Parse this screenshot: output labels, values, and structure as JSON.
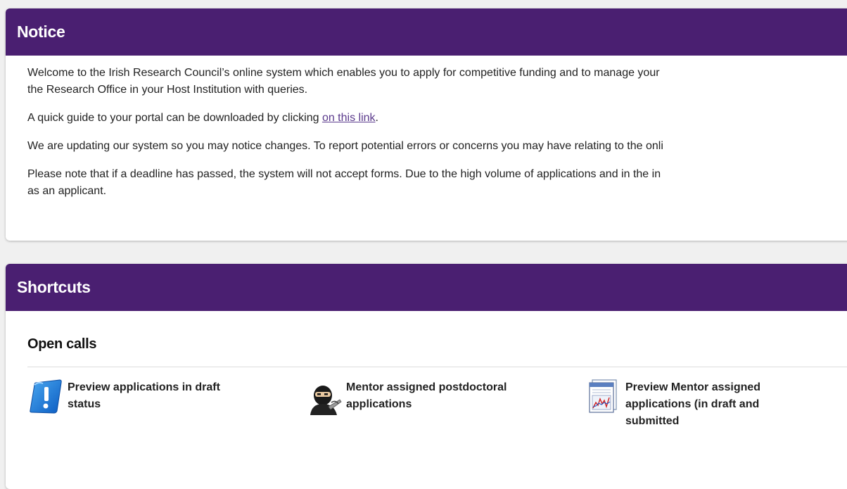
{
  "notice": {
    "title": "Notice",
    "line1": "Welcome to the Irish Research Council’s online system which enables you to apply for competitive funding and to manage your",
    "line2": "the Research Office in your Host Institution with queries.",
    "guide_text": "A quick guide to your portal can be downloaded by clicking ",
    "guide_link": "on this link",
    "guide_end": ".",
    "updating": "We are updating our system so you may notice changes. To report potential errors or concerns you may have relating to the onli",
    "deadline_line1": "Please note that if a deadline has passed, the system will not accept forms. Due to the high volume of applications and in the in",
    "deadline_line2": "as an applicant."
  },
  "shortcuts": {
    "title": "Shortcuts",
    "section_title": "Open calls",
    "items": [
      {
        "label": "Preview applications in draft status",
        "icon": "document-exclamation-icon"
      },
      {
        "label": "Mentor assigned postdoctoral applications",
        "icon": "ninja-icon"
      },
      {
        "label": "Preview Mentor assigned applications (in draft and submitted",
        "icon": "report-chart-icon"
      }
    ]
  },
  "colors": {
    "header_bg": "#4a1f71",
    "link": "#5b3a8c"
  }
}
